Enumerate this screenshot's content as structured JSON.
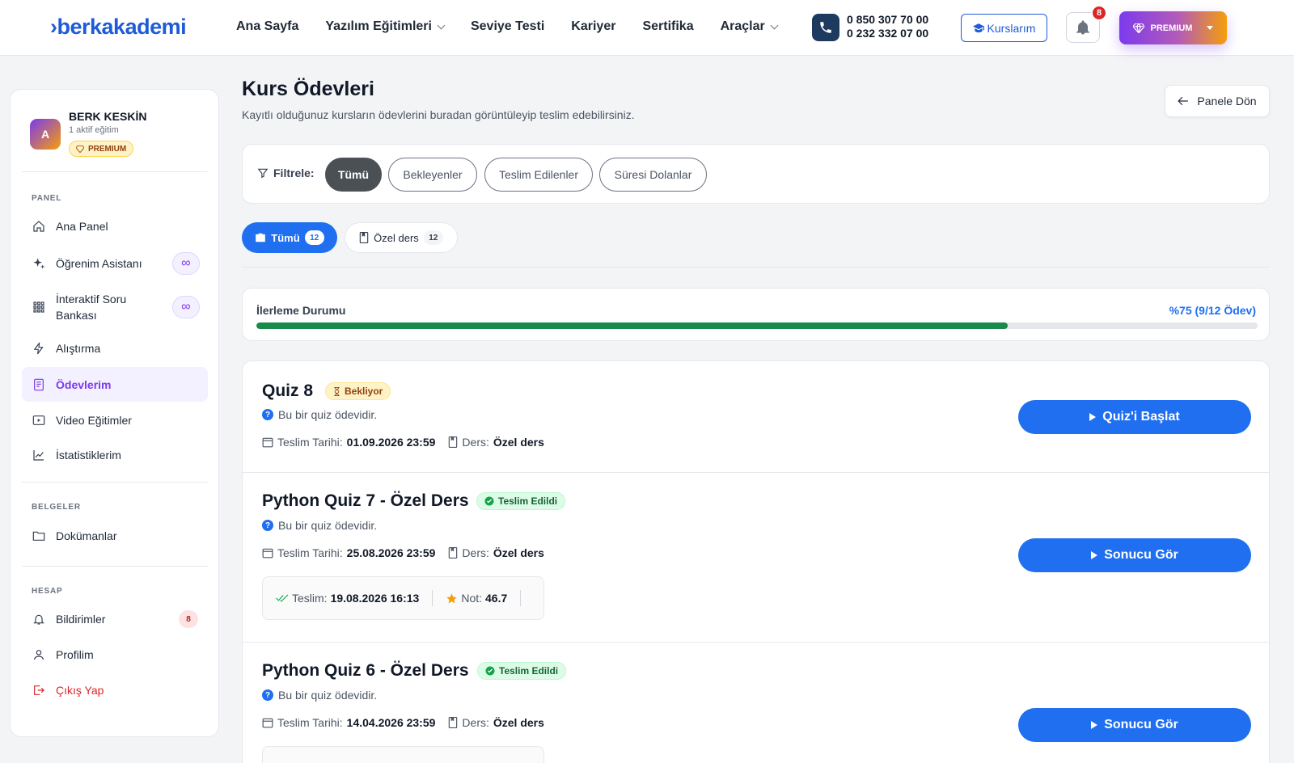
{
  "header": {
    "logo": "berkakademi",
    "nav": [
      {
        "label": "Ana Sayfa",
        "dropdown": false
      },
      {
        "label": "Yazılım Eğitimleri",
        "dropdown": true
      },
      {
        "label": "Seviye Testi",
        "dropdown": false
      },
      {
        "label": "Kariyer",
        "dropdown": false
      },
      {
        "label": "Sertifika",
        "dropdown": false
      },
      {
        "label": "Araçlar",
        "dropdown": true
      }
    ],
    "phone1": "0 850 307 70 00",
    "phone2": "0 232 332 07 00",
    "courses_label": "Kurslarım",
    "notif_count": "8",
    "premium_label": "PREMIUM"
  },
  "sidebar": {
    "user_initial": "A",
    "user_name": "BERK KESKİN",
    "user_sub": "1 aktif eğitim",
    "user_badge": "PREMIUM",
    "sections": {
      "panel": "PANEL",
      "docs": "BELGELER",
      "account": "HESAP"
    },
    "items": {
      "dashboard": "Ana Panel",
      "assistant": "Öğrenim Asistanı",
      "qbank": "İnteraktif Soru Bankası",
      "practice": "Alıştırma",
      "homework": "Ödevlerim",
      "videos": "Video Eğitimler",
      "stats": "İstatistiklerim",
      "documents": "Dokümanlar",
      "notifications": "Bildirimler",
      "profile": "Profilim",
      "logout": "Çıkış Yap"
    },
    "infinity": "∞",
    "notif_count": "8"
  },
  "main": {
    "title": "Kurs Ödevleri",
    "subtitle": "Kayıtlı olduğunuz kursların ödevlerini buradan görüntüleyip teslim edebilirsiniz.",
    "back_label": "Panele Dön",
    "filter_label": "Filtrele:",
    "filters": [
      "Tümü",
      "Bekleyenler",
      "Teslim Edilenler",
      "Süresi Dolanlar"
    ],
    "tabs": [
      {
        "label": "Tümü",
        "count": "12"
      },
      {
        "label": "Özel ders",
        "count": "12"
      }
    ],
    "progress": {
      "label": "İlerleme Durumu",
      "text": "%75 (9/12 Ödev)",
      "fraction": 0.75
    },
    "homeworks": [
      {
        "title": "Quiz 8",
        "status": "Bekliyor",
        "desc": "Bu bir quiz ödevidir.",
        "due_label": "Teslim Tarihi:",
        "due": "01.09.2026 23:59",
        "course_label": "Ders:",
        "course": "Özel ders",
        "button": "Quiz'i Başlat"
      },
      {
        "title": "Python Quiz 7 - Özel Ders",
        "status": "Teslim Edildi",
        "desc": "Bu bir quiz ödevidir.",
        "due_label": "Teslim Tarihi:",
        "due": "25.08.2026 23:59",
        "course_label": "Ders:",
        "course": "Özel ders",
        "submitted_label": "Teslim:",
        "submitted": "19.08.2026 16:13",
        "grade_label": "Not:",
        "grade": "46.7",
        "button": "Sonucu Gör"
      },
      {
        "title": "Python Quiz 6 - Özel Ders",
        "status": "Teslim Edildi",
        "desc": "Bu bir quiz ödevidir.",
        "due_label": "Teslim Tarihi:",
        "due": "14.04.2026 23:59",
        "course_label": "Ders:",
        "course": "Özel ders",
        "button": "Sonucu Gör"
      }
    ]
  },
  "colors": {
    "primary": "#1f6ff0",
    "brand": "#1e5bd8",
    "accent_purple": "#7c3aed",
    "progress_green": "#198a4a",
    "danger": "#dc2626"
  }
}
